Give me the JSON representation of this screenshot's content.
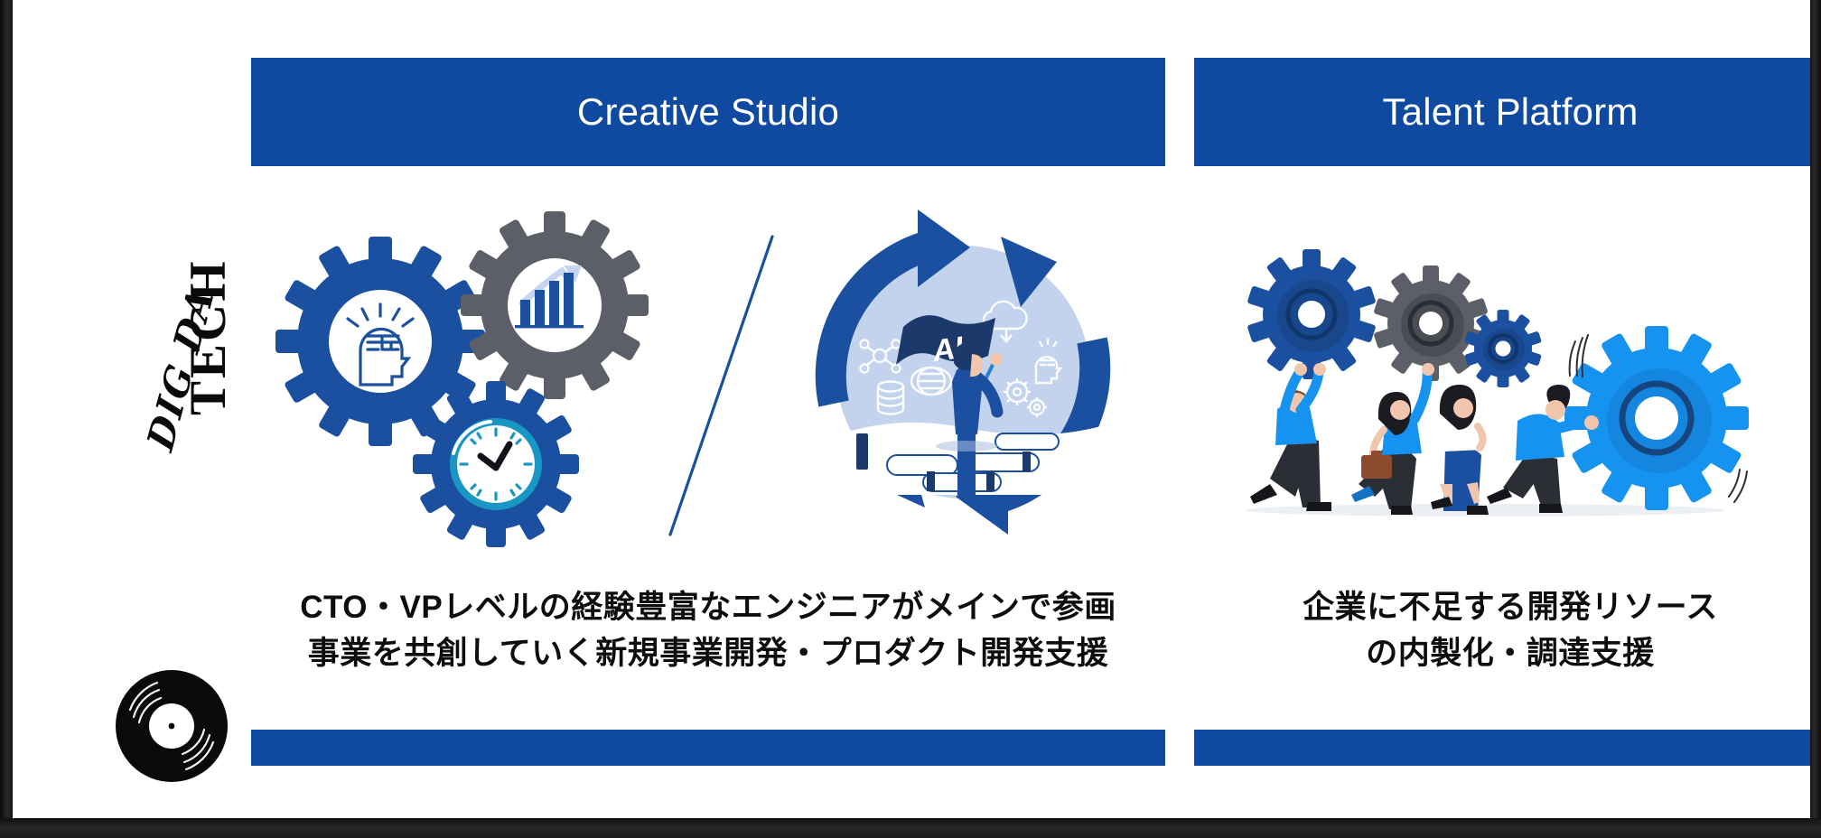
{
  "device": {
    "bezel_color": "#1a1a1a",
    "screen_background": "#ffffff"
  },
  "brand": {
    "accent_blue": "#0F49A0",
    "secondary_blue": "#1B4FA0",
    "bright_blue": "#1693F0",
    "gray": "#5C5F68",
    "logo_word_top": "TECH",
    "logo_word_bottom": "DIG DA",
    "logo_mark": "vinyl-record-icon"
  },
  "panels": [
    {
      "id": "creative-studio",
      "banner_title": "Creative Studio",
      "caption_lines": [
        "CTO・VPレベルの経験豊富なエンジニアがメインで参画",
        "事業を共創していく新規事業開発・プロダクト開発支援"
      ],
      "illustrations": [
        {
          "name": "three-gears-illustration",
          "elements": [
            "ai-brain-head-icon",
            "bar-chart-growth-icon",
            "clock-icon"
          ]
        },
        {
          "name": "ai-cycle-illustration",
          "flag_label": "AI",
          "elements": [
            "circular-arrows",
            "person-with-flag",
            "cloud-icon",
            "network-icon",
            "globe-icon",
            "database-icon",
            "brain-bulb-icon",
            "gears-icon"
          ]
        }
      ],
      "divider": "diagonal-slash"
    },
    {
      "id": "talent-platform",
      "banner_title": "Talent Platform",
      "caption_lines": [
        "企業に不足する開発リソース",
        "の内製化・調達支援"
      ],
      "illustrations": [
        {
          "name": "team-carrying-gears-illustration",
          "elements": [
            "gear-dark-blue",
            "gear-gray",
            "gear-small-blue",
            "gear-large-bright-blue",
            "person-running-man",
            "person-woman-briefcase",
            "person-woman-walking",
            "person-man-pushing"
          ]
        }
      ]
    }
  ]
}
